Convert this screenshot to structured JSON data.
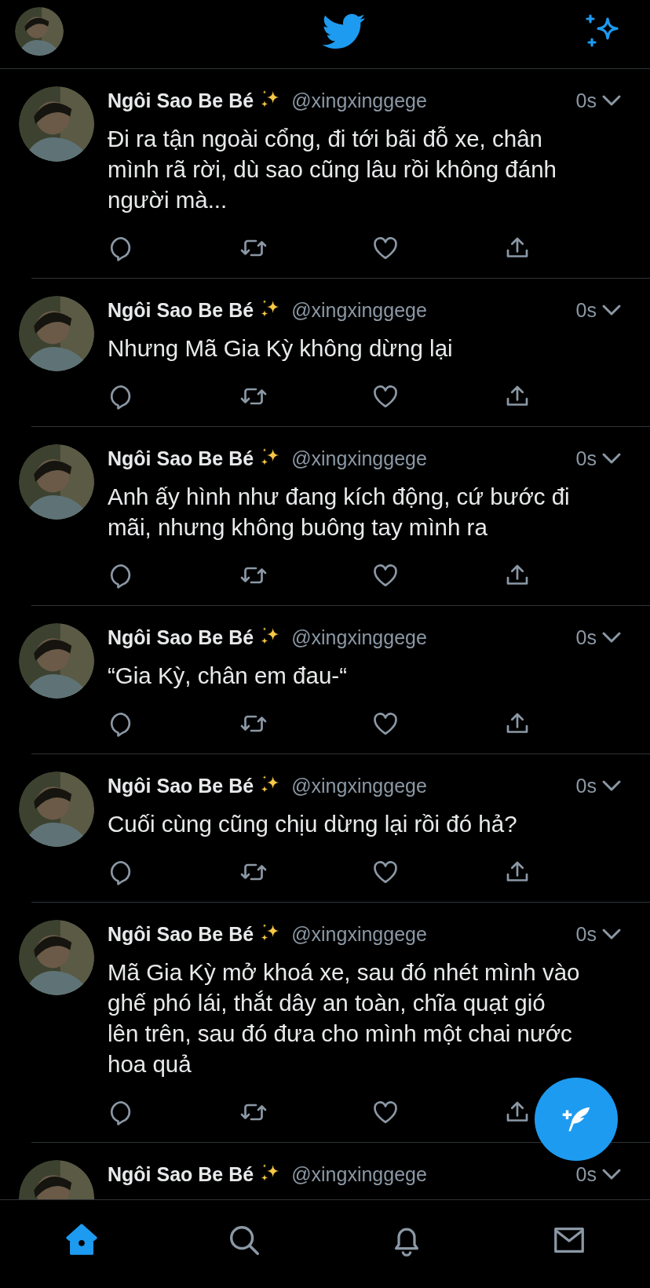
{
  "tweets": [
    {
      "name": "Ngôi Sao Be Bé",
      "handle": "@xingxinggege",
      "time": "0s",
      "text": "Đi ra tận ngoài cổng, đi tới bãi đỗ xe, chân mình rã rời, dù sao cũng lâu rồi không đánh người mà..."
    },
    {
      "name": "Ngôi Sao Be Bé",
      "handle": "@xingxinggege",
      "time": "0s",
      "text": "Nhưng Mã Gia Kỳ không dừng lại"
    },
    {
      "name": "Ngôi Sao Be Bé",
      "handle": "@xingxinggege",
      "time": "0s",
      "text": "Anh ấy hình như đang kích động, cứ bước đi mãi, nhưng không buông tay mình ra"
    },
    {
      "name": "Ngôi Sao Be Bé",
      "handle": "@xingxinggege",
      "time": "0s",
      "text": "“Gia Kỳ, chân em đau-“"
    },
    {
      "name": "Ngôi Sao Be Bé",
      "handle": "@xingxinggege",
      "time": "0s",
      "text": "Cuối cùng cũng chịu dừng lại rồi đó hả?"
    },
    {
      "name": "Ngôi Sao Be Bé",
      "handle": "@xingxinggege",
      "time": "0s",
      "text": "Mã Gia Kỳ mở khoá xe, sau đó nhét mình vào ghế phó lái, thắt dây an toàn, chĩa quạt gió lên trên, sau đó đưa cho mình một chai nước hoa quả"
    },
    {
      "name": "Ngôi Sao Be Bé",
      "handle": "@xingxinggege",
      "time": "0s"
    }
  ],
  "tabs": [
    {
      "kind": "home",
      "selected": true
    },
    {
      "kind": "search",
      "selected": false
    },
    {
      "kind": "notifications",
      "selected": false
    },
    {
      "kind": "messages",
      "selected": false
    }
  ]
}
